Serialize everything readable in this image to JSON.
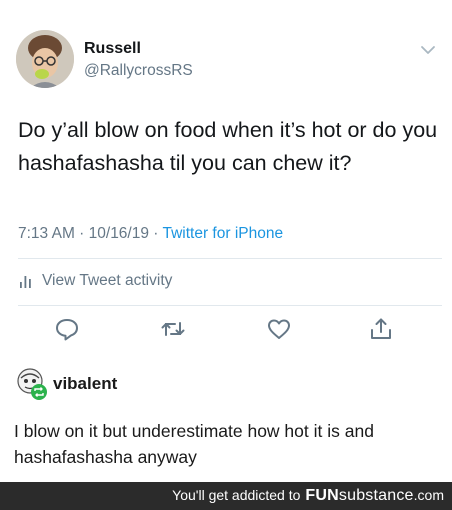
{
  "tweet": {
    "author_name": "Russell",
    "author_handle": "@RallycrossRS",
    "text": "Do y’all blow on food when it’s hot or do you hashafashasha til you can chew it?",
    "time": "7:13 AM · 10/16/19 · ",
    "source": "Twitter for iPhone",
    "activity_label": "View Tweet activity",
    "icons": {
      "menu": "chevron-down-icon",
      "activity": "bar-chart-icon",
      "reply": "reply-icon",
      "retweet": "retweet-icon",
      "like": "heart-icon",
      "share": "share-icon"
    }
  },
  "comment": {
    "username": "vibalent",
    "text": "I blow on it but underestimate how hot it is and hashafashasha anyway",
    "reblog_badge_color": "#2bb24c"
  },
  "footer": {
    "lead": "You'll get addicted to",
    "brand_fun": "FUN",
    "brand_sub": "substance",
    "domain": ".com"
  },
  "colors": {
    "text": "#14171a",
    "muted": "#657786",
    "link": "#1b95e0",
    "footer_bg": "#2b2b2b"
  }
}
